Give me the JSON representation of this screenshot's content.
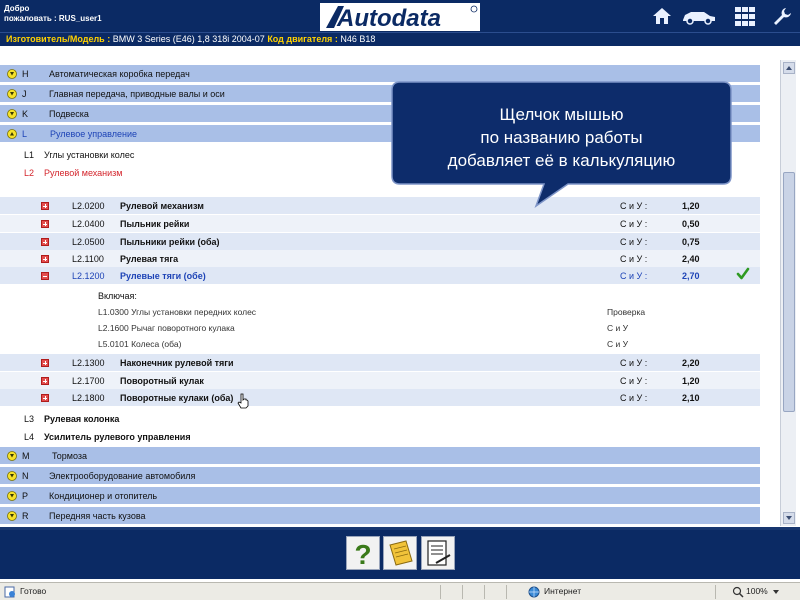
{
  "header": {
    "welcome_line1": "Добро",
    "welcome_line2": "пожаловать : RUS_user1",
    "logo": "Autodata",
    "icons": [
      "home-icon",
      "car-icon",
      "grid-icon",
      "wrench-icon"
    ]
  },
  "infobar": {
    "model_label": "Изготовитель/Модель :",
    "model_value": "BMW 3 Series (E46) 1,8 318i 2004-07",
    "engine_label": "Код двигателя :",
    "engine_value": "N46 B18"
  },
  "groups_top": [
    {
      "code": "H",
      "name": "Автоматическая коробка передач"
    },
    {
      "code": "J",
      "name": "Главная передача, приводные валы и оси"
    },
    {
      "code": "K",
      "name": "Подвеска"
    },
    {
      "code": "L",
      "name": "Рулевое управление"
    }
  ],
  "subsections": {
    "l1": {
      "code": "L1",
      "name": "Углы установки колес"
    },
    "l2": {
      "code": "L2",
      "name": "Рулевой механизм"
    },
    "l3": {
      "code": "L3",
      "name": "Рулевая колонка"
    },
    "l4": {
      "code": "L4",
      "name": "Усилитель рулевого управления"
    }
  },
  "operations": [
    {
      "code": "L2.0200",
      "name": "Рулевой механизм",
      "unit": "С и У :",
      "value": "1,20"
    },
    {
      "code": "L2.0400",
      "name": "Пыльник рейки",
      "unit": "С и У :",
      "value": "0,50"
    },
    {
      "code": "L2.0500",
      "name": "Пыльники рейки (оба)",
      "unit": "С и У :",
      "value": "0,75"
    },
    {
      "code": "L2.1100",
      "name": "Рулевая тяга",
      "unit": "С и У :",
      "value": "2,40"
    },
    {
      "code": "L2.1200",
      "name": "Рулевые тяги (обе)",
      "unit": "С и У :",
      "value": "2,70"
    }
  ],
  "includes": {
    "title": "Включая:",
    "items": [
      {
        "text": "L1.0300 Углы установки передних колес",
        "unit": "Проверка"
      },
      {
        "text": "L2.1600 Рычаг поворотного кулака",
        "unit": "С и У"
      },
      {
        "text": "L5.0101 Колеса (оба)",
        "unit": "С и У"
      }
    ]
  },
  "operations_after": [
    {
      "code": "L2.1300",
      "name": "Наконечник рулевой тяги",
      "unit": "С и У :",
      "value": "2,20"
    },
    {
      "code": "L2.1700",
      "name": "Поворотный кулак",
      "unit": "С и У :",
      "value": "1,20"
    },
    {
      "code": "L2.1800",
      "name": "Поворотные кулаки (оба)",
      "unit": "С и У :",
      "value": "2,10"
    }
  ],
  "groups_bottom": [
    {
      "code": "M",
      "name": "Тормоза"
    },
    {
      "code": "N",
      "name": "Электрооборудование автомобиля"
    },
    {
      "code": "P",
      "name": "Кондиционер и отопитель"
    },
    {
      "code": "R",
      "name": "Передняя часть кузова"
    }
  ],
  "callout": {
    "line1": "Щелчок мышью",
    "line2": "по названию работы",
    "line3": "добавляет её в калькуляцию"
  },
  "bottom_tools": [
    "help-icon",
    "notepad-icon",
    "report-icon"
  ],
  "help_glyph": "?",
  "status": {
    "ready": "Готово",
    "zone": "Интернет",
    "zoom": "100%"
  },
  "colors": {
    "header_bg": "#0b2a64",
    "label_yellow": "#ffd100",
    "group_row": "#a9bfe7",
    "active_blue": "#1d43b6",
    "red_text": "#d4262d",
    "check_green": "#2e9a22"
  }
}
